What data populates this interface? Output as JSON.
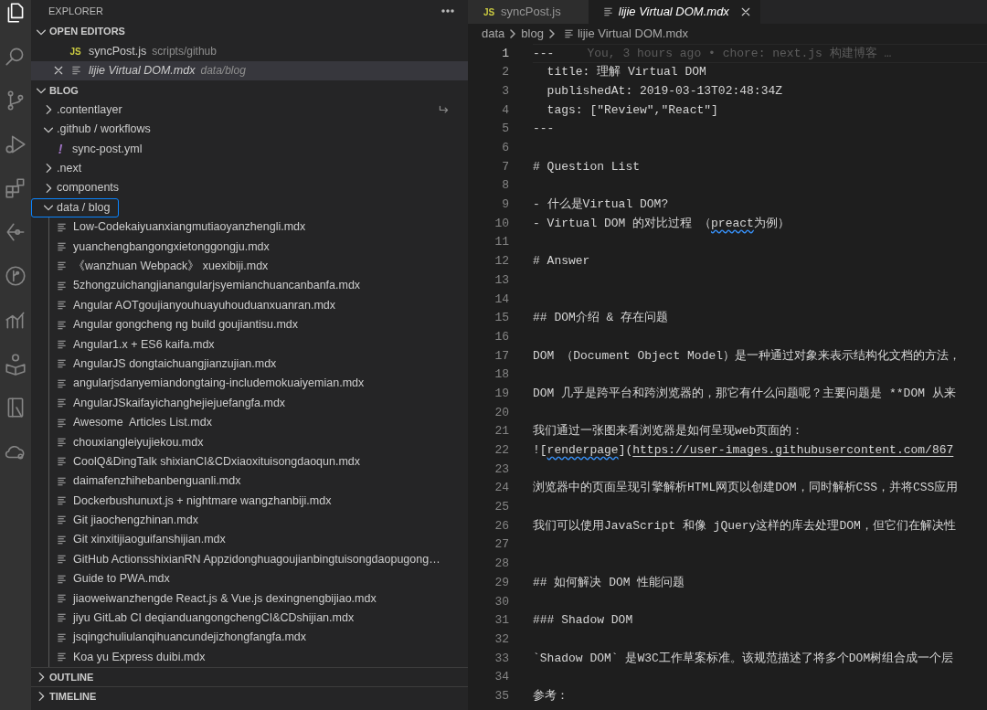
{
  "activity_bar": [
    {
      "selected": true
    },
    {
      "selected": false
    },
    {
      "selected": false
    },
    {
      "selected": false
    },
    {
      "selected": false
    },
    {
      "selected": false
    },
    {
      "selected": false
    },
    {
      "selected": false
    },
    {
      "selected": false
    },
    {
      "selected": false
    },
    {
      "selected": false
    }
  ],
  "sidebar": {
    "title": "EXPLORER",
    "open_editors": {
      "title": "OPEN EDITORS",
      "expanded": true,
      "items": [
        {
          "label": "syncPost.js",
          "description": "scripts/github",
          "kind": "js",
          "icon_text": "JS",
          "selected": false,
          "preview": false
        },
        {
          "label": "lijie Virtual DOM.mdx",
          "description": "data/blog",
          "kind": "markdown",
          "selected": true,
          "preview": true
        }
      ]
    },
    "folder": {
      "title": "BLOG",
      "expanded": true,
      "items": [
        {
          "label": ".contentlayer",
          "kind": "folder",
          "expanded": false,
          "focused": false,
          "symlink": true
        },
        {
          "label": ".github / workflows",
          "kind": "folder",
          "expanded": true,
          "focused": false,
          "symlink": false,
          "children": [
            {
              "label": "sync-post.yml",
              "kind": "yaml",
              "icon_text": "!"
            }
          ]
        },
        {
          "label": ".next",
          "kind": "folder",
          "expanded": false,
          "focused": false,
          "symlink": false
        },
        {
          "label": "components",
          "kind": "folder",
          "expanded": false,
          "focused": false,
          "symlink": false
        },
        {
          "label": "data / blog",
          "kind": "folder",
          "expanded": true,
          "focused": true,
          "symlink": false,
          "children": [
            {
              "label": "Low-Codekaiyuanxiangmutiaoyanzhengli.mdx",
              "kind": "markdown"
            },
            {
              "label": "yuanchengbangongxietonggongju.mdx",
              "kind": "markdown"
            },
            {
              "label": "《wanzhuan Webpack》 xuexibiji.mdx",
              "kind": "markdown"
            },
            {
              "label": "5zhongzuichangjianangularjsyemianchuancanbanfa.mdx",
              "kind": "markdown"
            },
            {
              "label": "Angular AOTgoujianyouhuayuhouduanxuanran.mdx",
              "kind": "markdown"
            },
            {
              "label": "Angular gongcheng ng build goujiantisu.mdx",
              "kind": "markdown"
            },
            {
              "label": "Angular1.x + ES6 kaifa.mdx",
              "kind": "markdown"
            },
            {
              "label": "AngularJS dongtaichuangjianzujian.mdx",
              "kind": "markdown"
            },
            {
              "label": "angularjsdanyemiandongtaing-includemokuaiyemian.mdx",
              "kind": "markdown"
            },
            {
              "label": "AngularJSkaifayichanghejiejuefangfa.mdx",
              "kind": "markdown"
            },
            {
              "label": "Awesome  Articles List.mdx",
              "kind": "markdown"
            },
            {
              "label": "chouxiangleiyujiekou.mdx",
              "kind": "markdown"
            },
            {
              "label": "CoolQ&DingTalk shixianCI&CDxiaoxituisongdaoqun.mdx",
              "kind": "markdown"
            },
            {
              "label": "daimafenzhihebanbenguanli.mdx",
              "kind": "markdown"
            },
            {
              "label": "Dockerbushunuxt.js + nightmare wangzhanbiji.mdx",
              "kind": "markdown"
            },
            {
              "label": "Git jiaochengzhinan.mdx",
              "kind": "markdown"
            },
            {
              "label": "Git xinxitijiaoguifanshijian.mdx",
              "kind": "markdown"
            },
            {
              "label": "GitHub ActionsshixianRN Appzidonghuagoujianbingtuisongdaopugong…",
              "kind": "markdown"
            },
            {
              "label": "Guide to PWA.mdx",
              "kind": "markdown"
            },
            {
              "label": "jiaoweiwanzhengde React.js & Vue.js dexingnengbijiao.mdx",
              "kind": "markdown"
            },
            {
              "label": "jiyu GitLab CI deqianduangongchengCI&CDshijian.mdx",
              "kind": "markdown"
            },
            {
              "label": "jsqingchuliulanqihuancundejizhongfangfa.mdx",
              "kind": "markdown"
            },
            {
              "label": "Koa yu Express duibi.mdx",
              "kind": "markdown"
            }
          ]
        }
      ]
    },
    "panels": [
      {
        "title": "OUTLINE",
        "expanded": false
      },
      {
        "title": "TIMELINE",
        "expanded": false
      }
    ]
  },
  "tabs": [
    {
      "label": "syncPost.js",
      "kind": "js",
      "icon_text": "JS",
      "selected": false,
      "preview": false
    },
    {
      "label": "lijie Virtual DOM.mdx",
      "kind": "markdown",
      "selected": true,
      "preview": true
    }
  ],
  "breadcrumb": [
    {
      "label": "data"
    },
    {
      "label": "blog"
    },
    {
      "label": "lijie Virtual DOM.mdx",
      "kind": "markdown"
    }
  ],
  "editor": {
    "lines": [
      {
        "number": "1",
        "active": true,
        "segments": [
          {
            "kind": "text",
            "text": "---"
          },
          {
            "kind": "blame",
            "text": "You, 3 hours ago • chore: next.js 构建博客 …"
          }
        ]
      },
      {
        "number": "2",
        "active": false,
        "segments": [
          {
            "kind": "text",
            "text": "  title: 理解 Virtual DOM"
          }
        ]
      },
      {
        "number": "3",
        "active": false,
        "segments": [
          {
            "kind": "text",
            "text": "  publishedAt: 2019-03-13T02:48:34Z"
          }
        ]
      },
      {
        "number": "4",
        "active": false,
        "segments": [
          {
            "kind": "text",
            "text": "  tags: [\"Review\",\"React\"]"
          }
        ]
      },
      {
        "number": "5",
        "active": false,
        "segments": [
          {
            "kind": "text",
            "text": "---"
          }
        ]
      },
      {
        "number": "6",
        "active": false
      },
      {
        "number": "7",
        "active": false,
        "segments": [
          {
            "kind": "text",
            "text": "# Question List"
          }
        ]
      },
      {
        "number": "8",
        "active": false
      },
      {
        "number": "9",
        "active": false,
        "segments": [
          {
            "kind": "text",
            "text": "- 什么是Virtual DOM?"
          }
        ]
      },
      {
        "number": "10",
        "active": false,
        "segments": [
          {
            "kind": "text",
            "text": "- Virtual DOM 的对比过程 （"
          },
          {
            "kind": "squiggle",
            "text": "preact"
          },
          {
            "kind": "text",
            "text": "为例）"
          }
        ]
      },
      {
        "number": "11",
        "active": false
      },
      {
        "number": "12",
        "active": false,
        "segments": [
          {
            "kind": "text",
            "text": "# Answer"
          }
        ]
      },
      {
        "number": "13",
        "active": false
      },
      {
        "number": "14",
        "active": false
      },
      {
        "number": "15",
        "active": false,
        "segments": [
          {
            "kind": "text",
            "text": "## DOM介绍 & 存在问题"
          }
        ]
      },
      {
        "number": "16",
        "active": false
      },
      {
        "number": "17",
        "active": false,
        "segments": [
          {
            "kind": "text",
            "text": "DOM （Document Object Model）是一种通过对象来表示结构化文档的方法，"
          }
        ]
      },
      {
        "number": "18",
        "active": false
      },
      {
        "number": "19",
        "active": false,
        "segments": [
          {
            "kind": "text",
            "text": "DOM 几乎是跨平台和跨浏览器的，那它有什么问题呢？主要问题是 **DOM 从来"
          }
        ]
      },
      {
        "number": "20",
        "active": false
      },
      {
        "number": "21",
        "active": false,
        "segments": [
          {
            "kind": "text",
            "text": "我们通过一张图来看浏览器是如何呈现web页面的："
          }
        ]
      },
      {
        "number": "22",
        "active": false,
        "segments": [
          {
            "kind": "text",
            "text": "!["
          },
          {
            "kind": "squiggle",
            "text": "renderpage"
          },
          {
            "kind": "text",
            "text": "]("
          },
          {
            "kind": "link",
            "text": "https://user-images.githubusercontent.com/867"
          }
        ]
      },
      {
        "number": "23",
        "active": false
      },
      {
        "number": "24",
        "active": false,
        "segments": [
          {
            "kind": "text",
            "text": "浏览器中的页面呈现引擎解析HTML网页以创建DOM，同时解析CSS，并将CSS应用"
          }
        ]
      },
      {
        "number": "25",
        "active": false
      },
      {
        "number": "26",
        "active": false,
        "segments": [
          {
            "kind": "text",
            "text": "我们可以使用JavaScript 和像 jQuery这样的库去处理DOM，但它们在解决性"
          }
        ]
      },
      {
        "number": "27",
        "active": false
      },
      {
        "number": "28",
        "active": false
      },
      {
        "number": "29",
        "active": false,
        "segments": [
          {
            "kind": "text",
            "text": "## 如何解决 DOM 性能问题"
          }
        ]
      },
      {
        "number": "30",
        "active": false
      },
      {
        "number": "31",
        "active": false,
        "segments": [
          {
            "kind": "text",
            "text": "### Shadow DOM"
          }
        ]
      },
      {
        "number": "32",
        "active": false
      },
      {
        "number": "33",
        "active": false,
        "segments": [
          {
            "kind": "text",
            "text": "`Shadow DOM` 是W3C工作草案标准。该规范描述了将多个DOM树组合成一个层"
          }
        ]
      },
      {
        "number": "34",
        "active": false
      },
      {
        "number": "35",
        "active": false,
        "segments": [
          {
            "kind": "text",
            "text": "参考："
          }
        ]
      }
    ]
  }
}
